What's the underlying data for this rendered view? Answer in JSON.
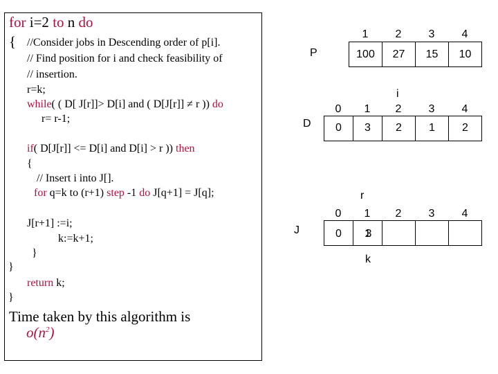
{
  "code": {
    "line1": {
      "k1": "for",
      "t1": " i=2 ",
      "k2": "to",
      "t2": " n ",
      "k3": "do"
    },
    "brace_open": "{",
    "comment1": "//Consider jobs in Descending order of p[i].",
    "comment2": "// Find position for i and  check feasibility of",
    "comment3": "// insertion.",
    "assign_r": "r=k;",
    "while_kw": "while",
    "while_cond": "( (  D[ J[r]]> D[i]  and ( D[J[r]] ≠ r )) ",
    "while_do": "do",
    "decrement": "r= r-1;",
    "if_kw": "if",
    "if_cond": "(  D[J[r]] <= D[i] and D[i]  > r )) ",
    "then_kw": "then",
    "inner_brace_open": "{",
    "comment4": "//  Insert i into  J[].",
    "for_kw": "for",
    "for_mid": " q=k to (r+1) ",
    "step_kw": "step",
    "step_val": " -1  ",
    "do_kw": "do",
    "for_body": " J[q+1] = J[q];",
    "assign_j": "J[r+1] :=i;",
    "increment_k": "k:=k+1;",
    "inner_brace_close": "}",
    "brace_close": "}",
    "return_kw": "return",
    "return_val": " k;",
    "func_close": "}",
    "time_text": "Time taken by this algorithm is",
    "complexity_base": "o(n",
    "complexity_exp": "2",
    "complexity_close": ")"
  },
  "arrays": {
    "P": {
      "label": "P",
      "indices": [
        "1",
        "2",
        "3",
        "4"
      ],
      "values": [
        "100",
        "27",
        "15",
        "10"
      ]
    },
    "D": {
      "label": "D",
      "pointer": "i",
      "indices": [
        "0",
        "1",
        "2",
        "3",
        "4"
      ],
      "values": [
        "0",
        "3",
        "2",
        "1",
        "2"
      ]
    },
    "J": {
      "label": "J",
      "pointer_top": "r",
      "pointer_bottom": "k",
      "indices": [
        "0",
        "1",
        "2",
        "3",
        "4"
      ],
      "values": [
        "0",
        "1",
        "",
        "",
        ""
      ],
      "overlay_value": "3"
    }
  },
  "colors": {
    "keyword": "#b0103e",
    "text": "#000000"
  }
}
